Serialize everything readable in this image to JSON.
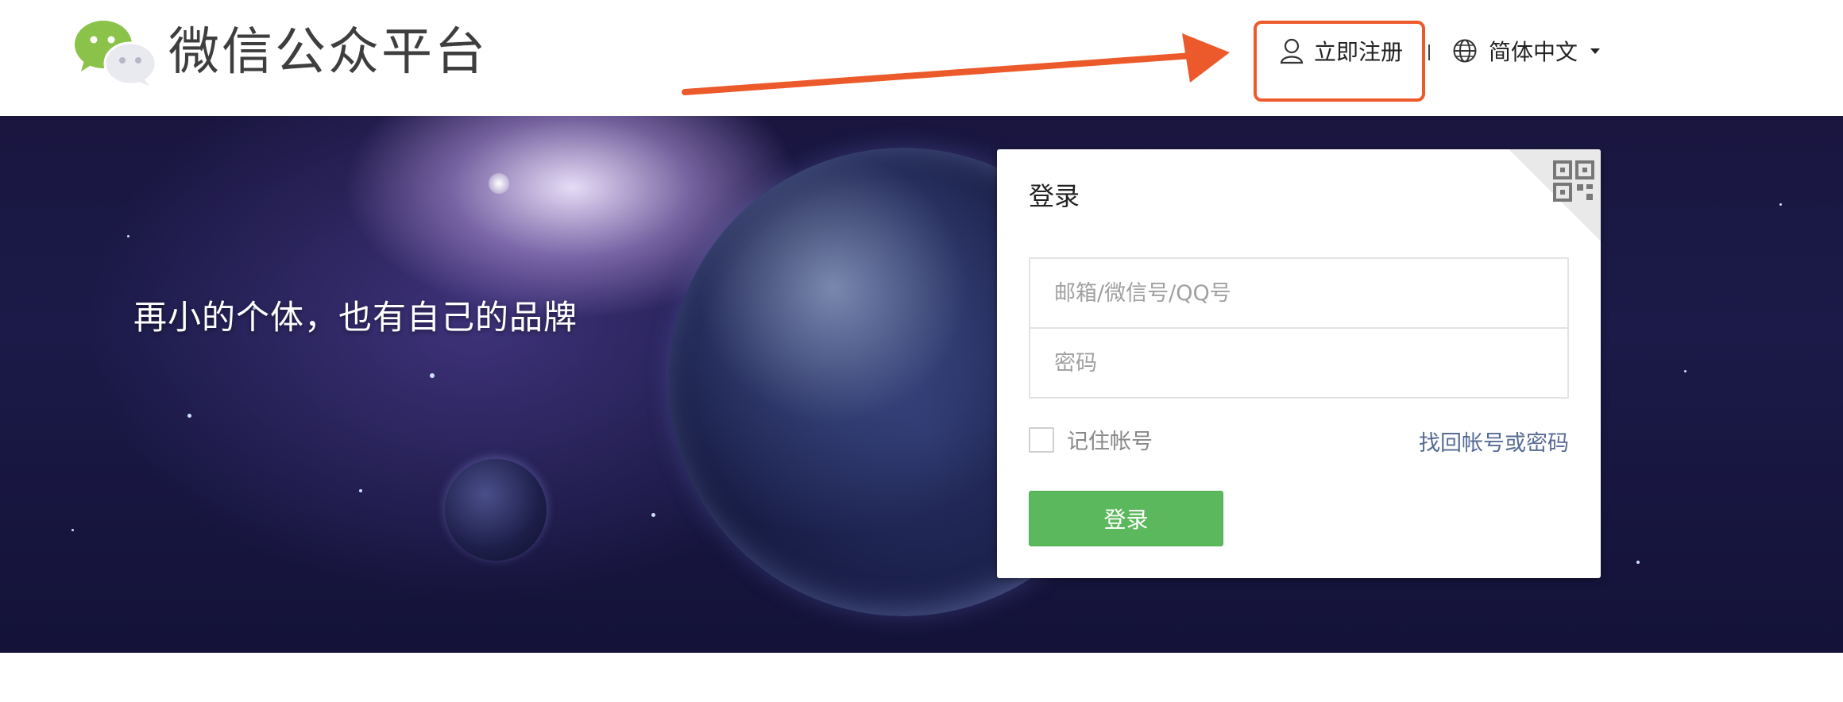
{
  "header": {
    "brand_title": "微信公众平台",
    "register_label": "立即注册",
    "language_label": "简体中文"
  },
  "banner": {
    "slogan": "再小的个体，也有自己的品牌"
  },
  "login": {
    "title": "登录",
    "account_placeholder": "邮箱/微信号/QQ号",
    "password_placeholder": "密码",
    "remember_label": "记住帐号",
    "forgot_label": "找回帐号或密码",
    "submit_label": "登录"
  },
  "colors": {
    "accent_green": "#5cb85c",
    "link_blue": "#576b95",
    "annotation_orange": "#ec5a2b"
  },
  "icons": [
    "wechat-logo-icon",
    "user-icon",
    "globe-icon",
    "caret-down-icon",
    "qr-code-icon"
  ]
}
